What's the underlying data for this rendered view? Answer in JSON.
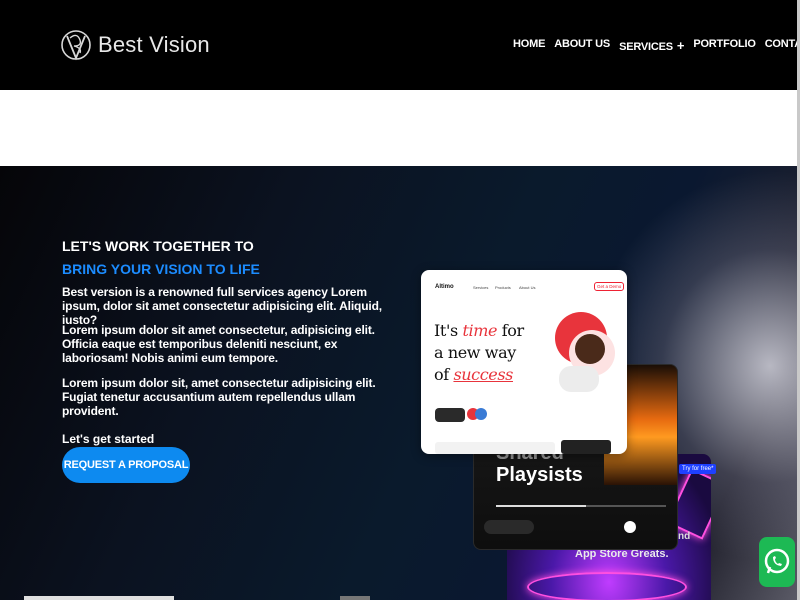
{
  "header": {
    "logo_text": "Best Vision",
    "nav": [
      {
        "label": "HOME"
      },
      {
        "label": "ABOUT US"
      },
      {
        "label": "SERVICES",
        "suffix": "+"
      },
      {
        "label": "PORTFOLIO"
      },
      {
        "label": "CONTACT"
      }
    ]
  },
  "hero": {
    "title": "LET'S WORK TOGETHER TO",
    "subtitle": "BRING YOUR VISION TO LIFE",
    "paragraphs": [
      "Best version is a renowned full services agency Lorem ipsum, dolor sit amet consectetur adipisicing elit. Aliquid, iusto?",
      "Lorem ipsum dolor sit amet consectetur, adipisicing elit. Officia eaque est temporibus deleniti nesciunt, ex laboriosam! Nobis animi eum tempore.",
      "Lorem ipsum dolor sit, amet consectetur adipisicing elit. Fugiat tenetur accusantium autem repellendus ullam provident."
    ],
    "get_started": "Let's get started",
    "cta_label": "REQUEST A PROPOSAL"
  },
  "mockups": {
    "white_card": {
      "brand": "Altimo",
      "nav": [
        "Services",
        "Products",
        "About Us"
      ],
      "button": "Get a Demo",
      "headline_1": "It's ",
      "headline_1_accent": "time",
      "headline_1_end": " for",
      "headline_2": "a new way",
      "headline_3": "of ",
      "headline_3_accent": "success"
    },
    "dark_card": {
      "title_1": "Shared",
      "title_2": "Playsists"
    },
    "purple_card": {
      "text": "App Store Greats.",
      "side_text": "nd",
      "badge": "Try for free*"
    }
  },
  "colors": {
    "accent_blue": "#0d8af0",
    "subtitle_blue": "#1c8cff",
    "header_bg": "#000000",
    "whatsapp_green": "#1db954"
  },
  "icons": {
    "logo": "bv-logo-icon",
    "floating": "whatsapp-icon"
  }
}
